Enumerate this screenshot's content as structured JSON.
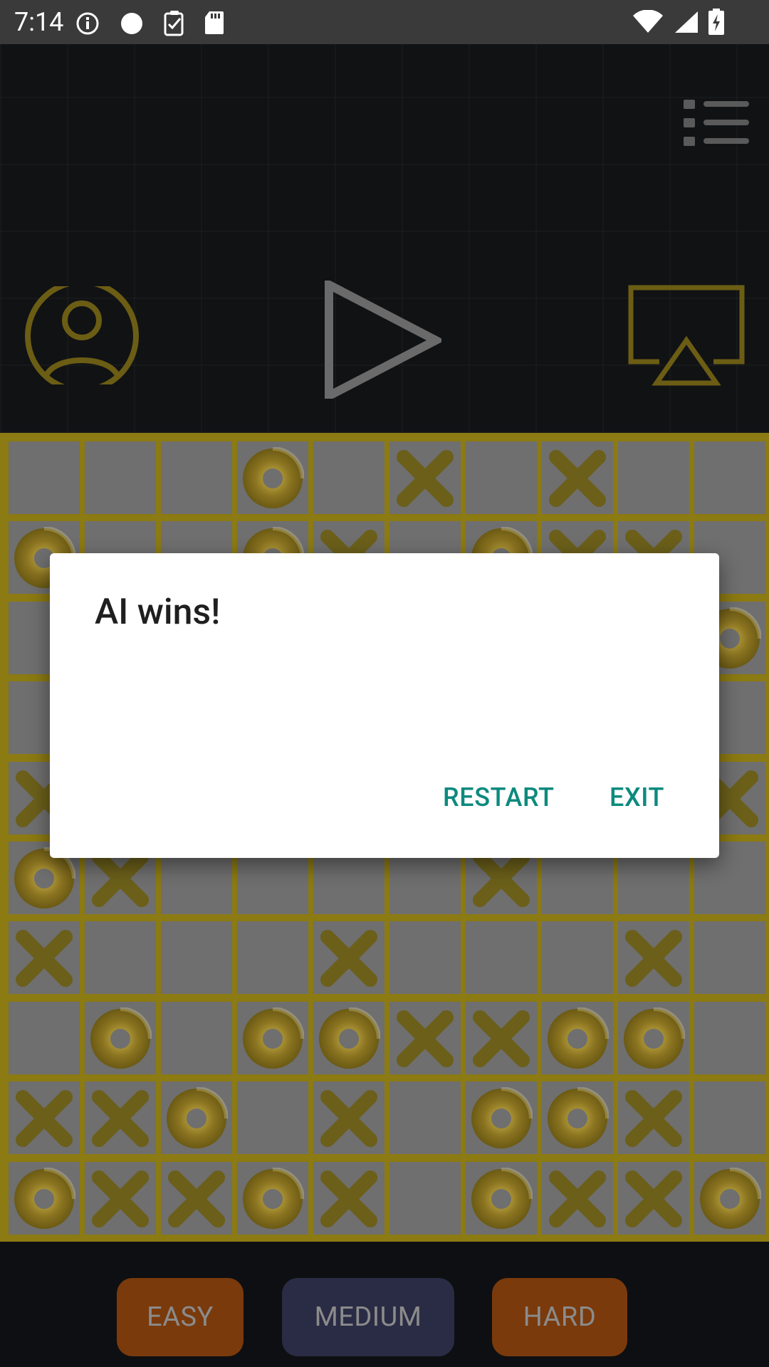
{
  "status_bar": {
    "time": "7:14",
    "left_icons": [
      "info-icon",
      "circle-dot-icon",
      "clipboard-check-icon",
      "sd-card-icon"
    ],
    "right_icons": [
      "wifi-icon",
      "signal-icon",
      "battery-charging-icon"
    ]
  },
  "header": {
    "menu_icon": "list-menu-icon",
    "profile_icon": "user-profile-icon",
    "play_icon": "play-icon",
    "cast_icon": "airplay-cast-icon"
  },
  "board": {
    "rows": 10,
    "cols": 10,
    "cells": [
      [
        "",
        "",
        "",
        "O",
        "",
        "X",
        "",
        "X",
        "",
        ""
      ],
      [
        "O",
        "",
        "",
        "O",
        "X",
        "",
        "O",
        "X",
        "X",
        ""
      ],
      [
        "",
        "",
        "",
        "",
        "",
        "",
        "",
        "",
        "",
        "O"
      ],
      [
        "",
        "",
        "",
        "",
        "",
        "",
        "",
        "",
        "",
        ""
      ],
      [
        "X",
        "",
        "",
        "",
        "",
        "",
        "",
        "",
        "",
        "X"
      ],
      [
        "O",
        "X",
        "",
        "",
        "",
        "",
        "X",
        "",
        "",
        ""
      ],
      [
        "X",
        "",
        "",
        "",
        "X",
        "",
        "",
        "",
        "X",
        ""
      ],
      [
        "",
        "O",
        "",
        "O",
        "O",
        "X",
        "X",
        "O",
        "O",
        ""
      ],
      [
        "X",
        "X",
        "O",
        "",
        "X",
        "",
        "O",
        "O",
        "X",
        ""
      ],
      [
        "O",
        "X",
        "X",
        "O",
        "X",
        "",
        "O",
        "X",
        "X",
        "O"
      ]
    ]
  },
  "dialog": {
    "title": "AI wins!",
    "restart_label": "RESTART",
    "exit_label": "EXIT"
  },
  "difficulty": {
    "easy": "EASY",
    "medium": "MEDIUM",
    "hard": "HARD"
  },
  "colors": {
    "gold": "#8a7a1a",
    "cell_gray": "#6f6f6f",
    "dialog_button": "#0c8a7e",
    "easy_bg": "#7a3a0c",
    "medium_bg": "#2a2c45",
    "hard_bg": "#7a3a0c"
  }
}
